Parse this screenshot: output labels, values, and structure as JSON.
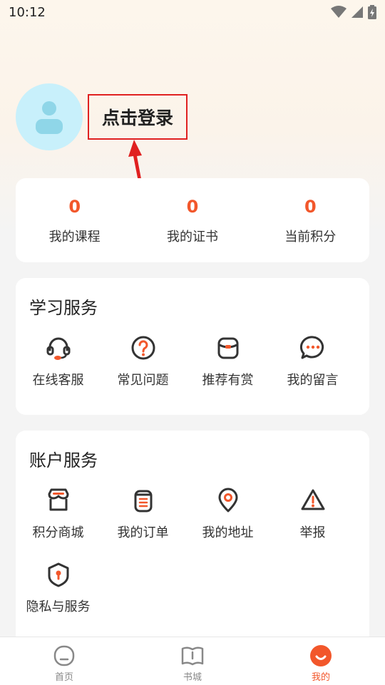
{
  "status_bar": {
    "time": "10:12"
  },
  "profile": {
    "login_label": "点击登录"
  },
  "stats": [
    {
      "value": "0",
      "label": "我的课程"
    },
    {
      "value": "0",
      "label": "我的证书"
    },
    {
      "value": "0",
      "label": "当前积分"
    }
  ],
  "study_services": {
    "title": "学习服务",
    "items": [
      {
        "label": "在线客服",
        "icon": "headset-icon"
      },
      {
        "label": "常见问题",
        "icon": "question-icon"
      },
      {
        "label": "推荐有赏",
        "icon": "reward-icon"
      },
      {
        "label": "我的留言",
        "icon": "chat-icon"
      }
    ]
  },
  "account_services": {
    "title": "账户服务",
    "items": [
      {
        "label": "积分商城",
        "icon": "store-icon"
      },
      {
        "label": "我的订单",
        "icon": "order-icon"
      },
      {
        "label": "我的地址",
        "icon": "location-icon"
      },
      {
        "label": "举报",
        "icon": "warning-icon"
      },
      {
        "label": "隐私与服务",
        "icon": "shield-icon"
      }
    ]
  },
  "bottom_nav": [
    {
      "label": "首页",
      "icon": "home-icon"
    },
    {
      "label": "书城",
      "icon": "book-icon"
    },
    {
      "label": "我的",
      "icon": "profile-icon",
      "active": true
    }
  ],
  "colors": {
    "accent": "#f2572b",
    "highlight": "#e02020",
    "avatar_bg": "#c8f0fb"
  }
}
